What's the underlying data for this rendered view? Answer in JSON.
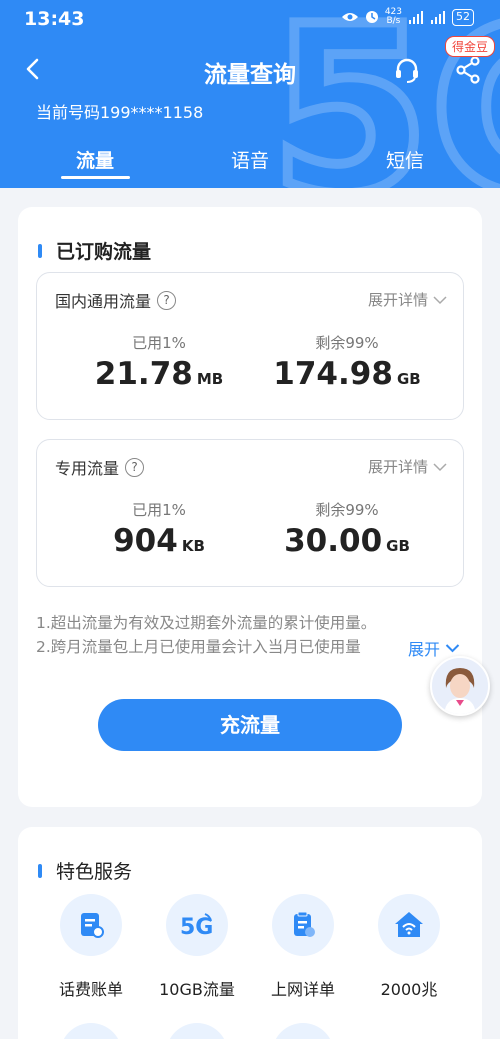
{
  "status_bar": {
    "time": "13:43",
    "speed_value": "423",
    "speed_unit": "B/s",
    "battery": "52"
  },
  "header": {
    "title": "流量查询",
    "phone": "当前号码199****1158",
    "bean_badge": "得金豆",
    "tabs": [
      {
        "label": "流量",
        "active": true
      },
      {
        "label": "语音",
        "active": false
      },
      {
        "label": "短信",
        "active": false
      }
    ]
  },
  "subscribed": {
    "section_title": "已订购流量",
    "expand_label": "展开详情",
    "boxes": [
      {
        "label": "国内通用流量",
        "used_label": "已用1%",
        "used_value": "21.78",
        "used_unit": "MB",
        "remaining_label": "剩余99%",
        "remaining_value": "174.98",
        "remaining_unit": "GB"
      },
      {
        "label": "专用流量",
        "used_label": "已用1%",
        "used_value": "904",
        "used_unit": "KB",
        "remaining_label": "剩余99%",
        "remaining_value": "30.00",
        "remaining_unit": "GB"
      }
    ],
    "notes": [
      "1.超出流量为有效及过期套外流量的累计使用量。",
      "2.跨月流量包上月已使用量会计入当月已使用量"
    ],
    "more_label": "展开",
    "recharge_label": "充流量"
  },
  "services": {
    "section_title": "特色服务",
    "items": [
      {
        "label": "话费账单",
        "icon": "bill-icon"
      },
      {
        "label": "10GB流量",
        "icon": "5g-icon"
      },
      {
        "label": "上网详单",
        "icon": "detail-list-icon"
      },
      {
        "label": "2000兆",
        "icon": "broadband-icon"
      }
    ]
  },
  "colors": {
    "primary": "#2f8af5",
    "background": "#f2f4f8"
  }
}
